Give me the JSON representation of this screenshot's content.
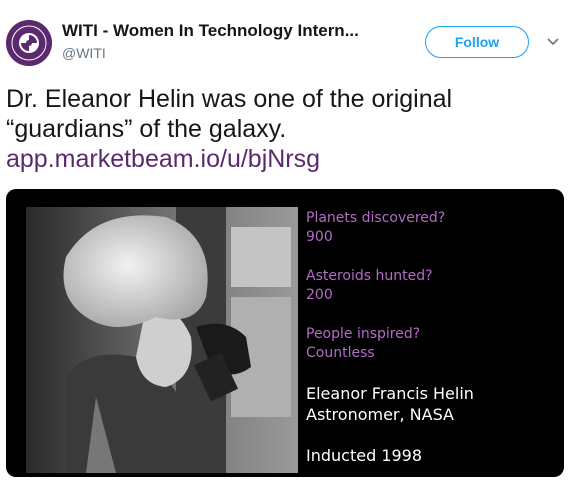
{
  "account": {
    "display_name": "WITI - Women In Technology Intern...",
    "handle": "@WITI",
    "avatar_icon": "witi-logo",
    "follow_label": "Follow",
    "caret_icon": "chevron-down-icon"
  },
  "tweet": {
    "text_line1": "Dr. Eleanor Helin was one of the original",
    "text_line2": "“guardians” of the galaxy.",
    "link": "app.marketbeam.io/u/bjNrsg"
  },
  "media": {
    "q1": "Planets discovered?",
    "a1": "900",
    "q2": "Asteroids hunted?",
    "a2": "200",
    "q3": "People inspired?",
    "a3": "Countless",
    "name": "Eleanor Francis Helin",
    "title": "Astronomer, NASA",
    "inducted": "Inducted 1998"
  },
  "colors": {
    "brand": "#5b2a6e",
    "follow_blue": "#1da1f2",
    "caption_purple": "#b36cc8"
  }
}
